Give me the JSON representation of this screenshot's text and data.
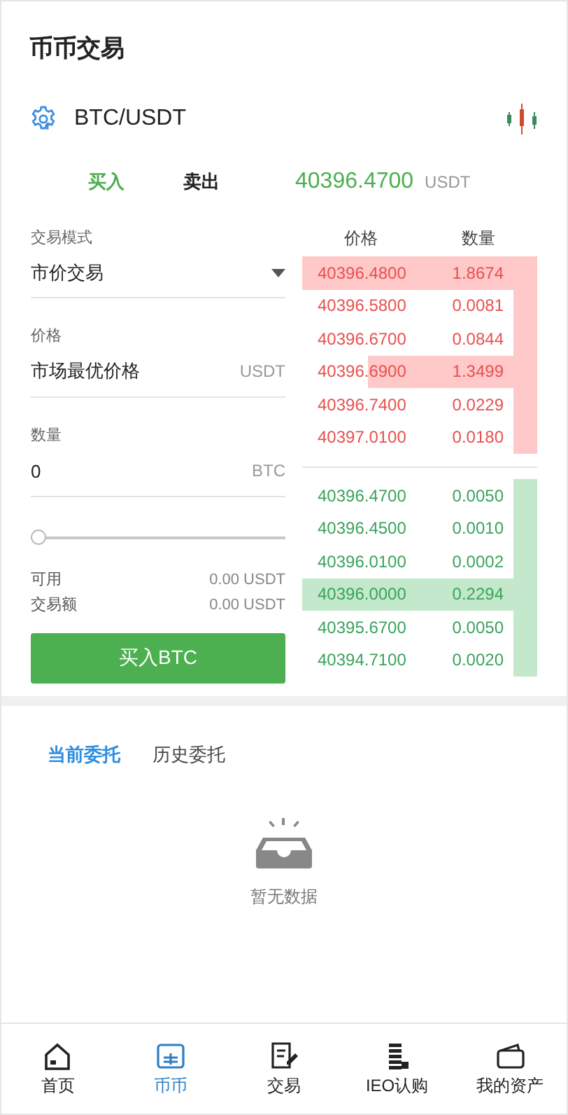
{
  "header": {
    "title": "币币交易"
  },
  "pair": {
    "symbol": "BTC/USDT"
  },
  "side_tabs": [
    {
      "label": "买入",
      "selected": true
    },
    {
      "label": "卖出",
      "selected": false
    }
  ],
  "last_price": {
    "value": "40396.4700",
    "unit": "USDT"
  },
  "form": {
    "mode_label": "交易模式",
    "mode_value": "市价交易",
    "price_label": "价格",
    "price_value": "市场最优价格",
    "price_unit": "USDT",
    "amount_label": "数量",
    "amount_value": "0",
    "amount_unit": "BTC",
    "slider": {
      "level": 0
    },
    "available_label": "可用",
    "available_value": "0.00 USDT",
    "total_label": "交易额",
    "total_value": "0.00 USDT",
    "submit": "买入BTC"
  },
  "order_book": {
    "columns": [
      "价格",
      "数量"
    ],
    "asks": [
      {
        "price": "40396.4800",
        "amount": "1.8674"
      },
      {
        "price": "40396.5800",
        "amount": "0.0081"
      },
      {
        "price": "40396.6700",
        "amount": "0.0844"
      },
      {
        "price": "40396.6900",
        "amount": "1.3499"
      },
      {
        "price": "40396.7400",
        "amount": "0.0229"
      },
      {
        "price": "40397.0100",
        "amount": "0.0180"
      }
    ],
    "bids": [
      {
        "price": "40396.4700",
        "amount": "0.0050"
      },
      {
        "price": "40396.4500",
        "amount": "0.0010"
      },
      {
        "price": "40396.0100",
        "amount": "0.0002"
      },
      {
        "price": "40396.0000",
        "amount": "0.2294"
      },
      {
        "price": "40395.6700",
        "amount": "0.0050"
      },
      {
        "price": "40394.7100",
        "amount": "0.0020"
      }
    ]
  },
  "order_tabs": [
    {
      "label": "当前委托",
      "selected": true
    },
    {
      "label": "历史委托",
      "selected": false
    }
  ],
  "empty_text": "暂无数据",
  "nav": [
    {
      "kind": "home",
      "label": "首页",
      "selected": false
    },
    {
      "kind": "coin",
      "label": "币币",
      "selected": true
    },
    {
      "kind": "trade",
      "label": "交易",
      "selected": false
    },
    {
      "kind": "ieo",
      "label": "IEO认购",
      "selected": false
    },
    {
      "kind": "wallet",
      "label": "我的资产",
      "selected": false
    }
  ]
}
